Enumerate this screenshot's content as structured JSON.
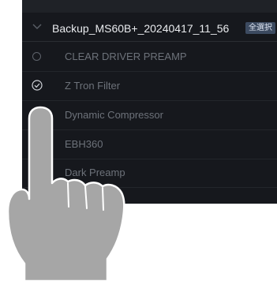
{
  "group": {
    "title": "Backup_MS60B+_20240417_11_56",
    "select_all_label": "全選択"
  },
  "items": [
    {
      "label": "CLEAR DRIVER PREAMP",
      "checked": false
    },
    {
      "label": "Z Tron Filter",
      "checked": true
    },
    {
      "label": "Dynamic Compressor",
      "checked": false
    },
    {
      "label": "EBH360",
      "checked": false
    },
    {
      "label": "Dark Preamp",
      "checked": false
    },
    {
      "label": "B",
      "checked": false
    }
  ],
  "colors": {
    "panel_bg": "#16181d",
    "text_primary": "#e9ebee",
    "text_dim": "#6d727a",
    "badge_bg": "#3c4a60",
    "hand": "#a6a6a6"
  }
}
